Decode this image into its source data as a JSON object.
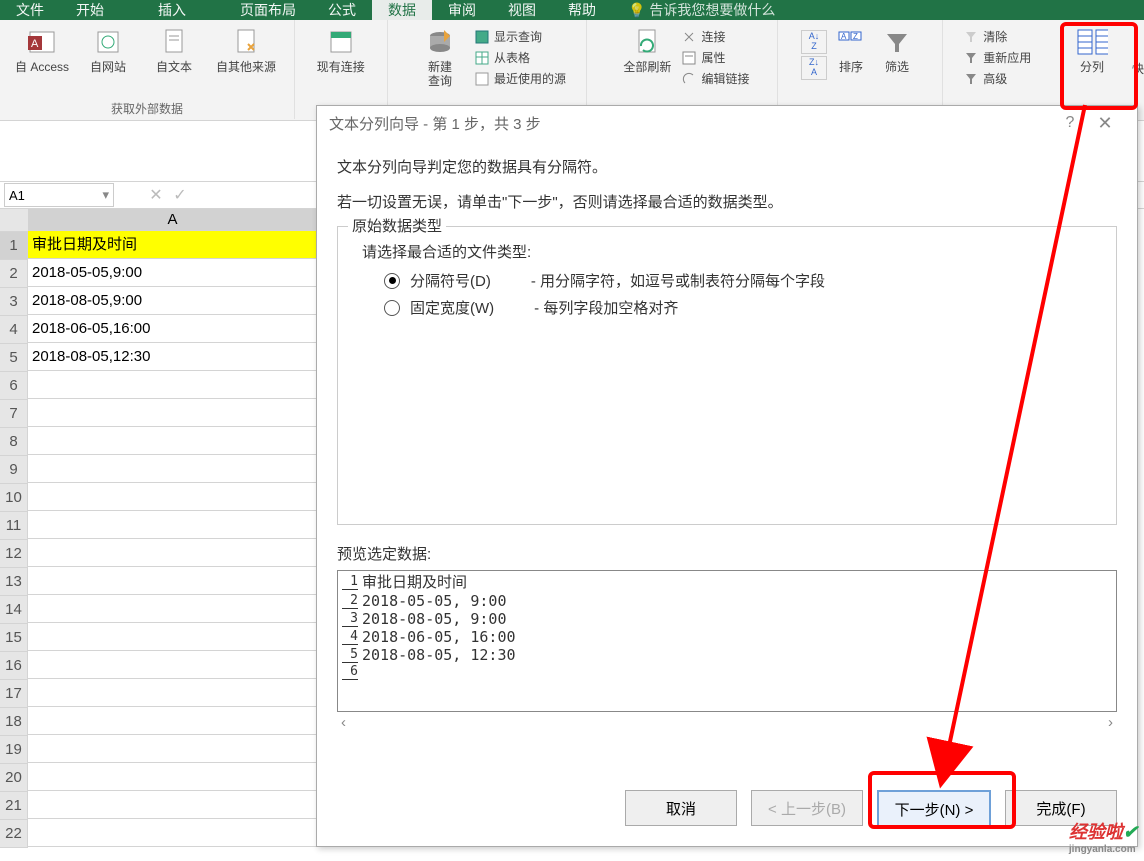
{
  "tabs": {
    "file": "文件",
    "start": "开始",
    "insert": "插入",
    "layout": "页面布局",
    "formula": "公式",
    "data": "数据",
    "review": "审阅",
    "view": "视图",
    "help": "帮助",
    "tell": "告诉我您想要做什么"
  },
  "ribbon": {
    "access": "自 Access",
    "web": "自网站",
    "text": "自文本",
    "other": "自其他来源",
    "existing": "现有连接",
    "newquery": "新建\n查询",
    "showquery": "显示查询",
    "fromtable": "从表格",
    "recent": "最近使用的源",
    "refresh": "全部刷新",
    "conn": "连接",
    "prop": "属性",
    "editlink": "编辑链接",
    "sortAZ": "A\nZ",
    "sortZA": "Z\nA",
    "sort": "排序",
    "filter": "筛选",
    "clear": "清除",
    "reapply": "重新应用",
    "adv": "高级",
    "split": "分列",
    "quick": "快"
  },
  "ribbon_groups": {
    "getdata": "获取外部数据"
  },
  "namebox": "A1",
  "colA_header": "A",
  "rows": {
    "1": "审批日期及时间",
    "2": "2018-05-05,9:00",
    "3": "2018-08-05,9:00",
    "4": "2018-06-05,16:00",
    "5": "2018-08-05,12:30"
  },
  "dialog": {
    "title": "文本分列向导 - 第 1 步，共 3 步",
    "help": "?",
    "line1": "文本分列向导判定您的数据具有分隔符。",
    "line2": "若一切设置无误，请单击\"下一步\"，否则请选择最合适的数据类型。",
    "legend": "原始数据类型",
    "choose": "请选择最合适的文件类型:",
    "opt1": "分隔符号(D)",
    "opt1desc": "- 用分隔字符，如逗号或制表符分隔每个字段",
    "opt2": "固定宽度(W)",
    "opt2desc": "- 每列字段加空格对齐",
    "previewlabel": "预览选定数据:",
    "p1": "审批日期及时间",
    "p2": "2018-05-05, 9:00",
    "p3": "2018-08-05, 9:00",
    "p4": "2018-06-05, 16:00",
    "p5": "2018-08-05, 12:30",
    "cancel": "取消",
    "back": "< 上一步(B)",
    "next": "下一步(N) >",
    "finish": "完成(F)"
  },
  "watermark": {
    "main": "经验啦",
    "sub": "jingyanla.com"
  }
}
